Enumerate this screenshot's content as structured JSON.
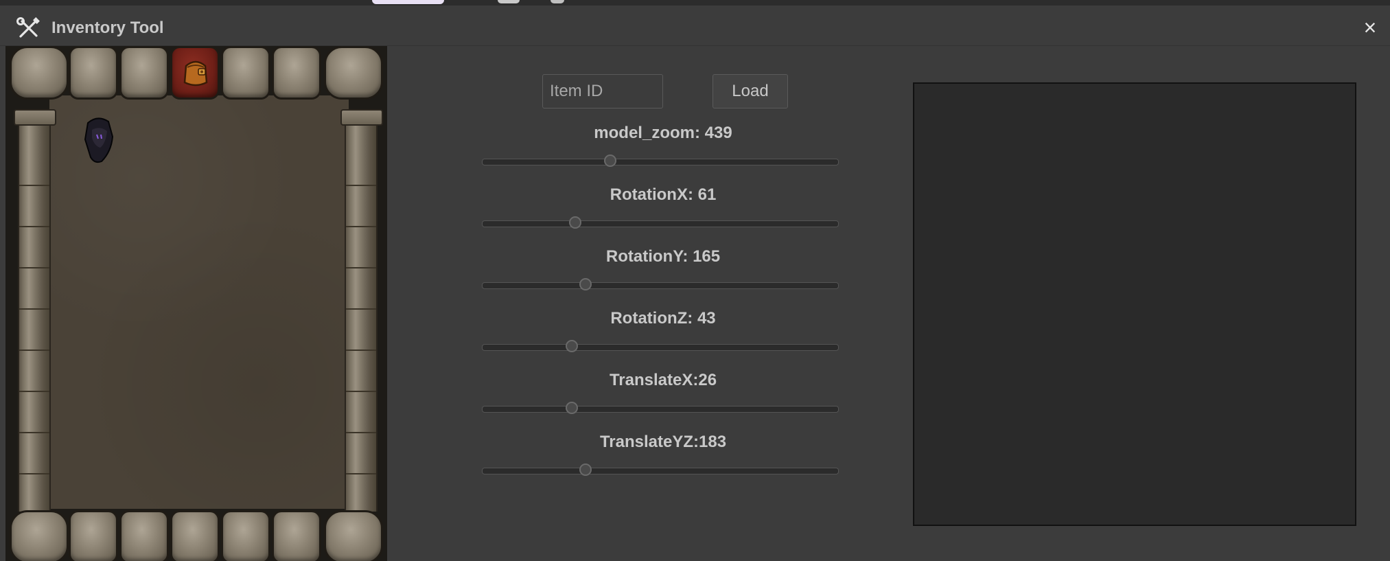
{
  "window": {
    "title": "Inventory Tool",
    "close_label": "×",
    "app_icon": "wrench-screwdriver-icon"
  },
  "inventory": {
    "items": [
      {
        "slot": 0,
        "icon": "dark-hood-item-icon"
      }
    ],
    "active_tab_icon": "backpack-icon"
  },
  "controls": {
    "item_id_placeholder": "Item ID",
    "item_id_value": "",
    "load_label": "Load",
    "sliders": [
      {
        "label": "model_zoom: 439",
        "level": 0.36
      },
      {
        "label": "RotationX: 61",
        "level": 0.26
      },
      {
        "label": "RotationY: 165",
        "level": 0.29
      },
      {
        "label": "RotationZ: 43",
        "level": 0.25
      },
      {
        "label": "TranslateX:26",
        "level": 0.25
      },
      {
        "label": "TranslateYZ:183",
        "level": 0.29
      }
    ]
  },
  "colors": {
    "window_bg": "#3c3c3c",
    "preview_bg": "#2a2a2a",
    "text": "#c9c9c9",
    "active_tab": "#6e1f17"
  }
}
